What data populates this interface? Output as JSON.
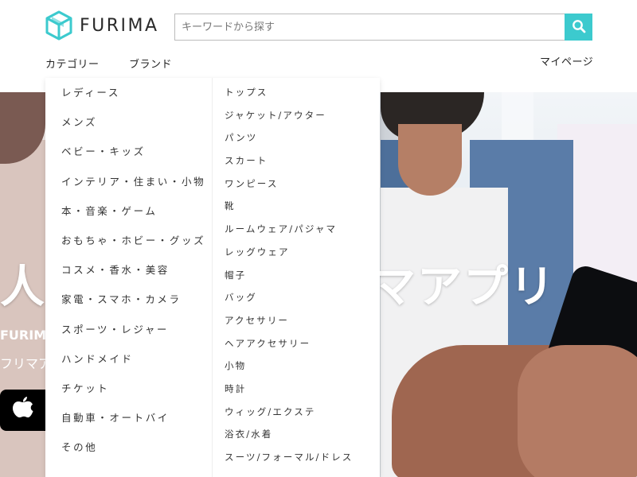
{
  "header": {
    "logo_text": "FURIMA",
    "search": {
      "placeholder": "キーワードから探す",
      "value": ""
    },
    "nav": {
      "category": "カテゴリー",
      "brand": "ブランド",
      "mypage": "マイページ"
    }
  },
  "hero": {
    "title_left": "人",
    "title_right": "マアプリ",
    "sub1": "FURIMA",
    "sub2": "フリマア"
  },
  "dropdown": {
    "categories": [
      "レディース",
      "メンズ",
      "ベビー・キッズ",
      "インテリア・住まい・小物",
      "本・音楽・ゲーム",
      "おもちゃ・ホビー・グッズ",
      "コスメ・香水・美容",
      "家電・スマホ・カメラ",
      "スポーツ・レジャー",
      "ハンドメイド",
      "チケット",
      "自動車・オートバイ",
      "その他"
    ],
    "subcategories": [
      "トップス",
      "ジャケット/アウター",
      "パンツ",
      "スカート",
      "ワンピース",
      "靴",
      "ルームウェア/パジャマ",
      "レッグウェア",
      "帽子",
      "バッグ",
      "アクセサリー",
      "ヘアアクセサリー",
      "小物",
      "時計",
      "ウィッグ/エクステ",
      "浴衣/水着",
      "スーツ/フォーマル/ドレス"
    ]
  },
  "colors": {
    "accent": "#3ccace",
    "text": "#333333"
  },
  "icons": {
    "logo": "cube-logo-icon",
    "search": "search-icon",
    "store": "apple-icon"
  }
}
